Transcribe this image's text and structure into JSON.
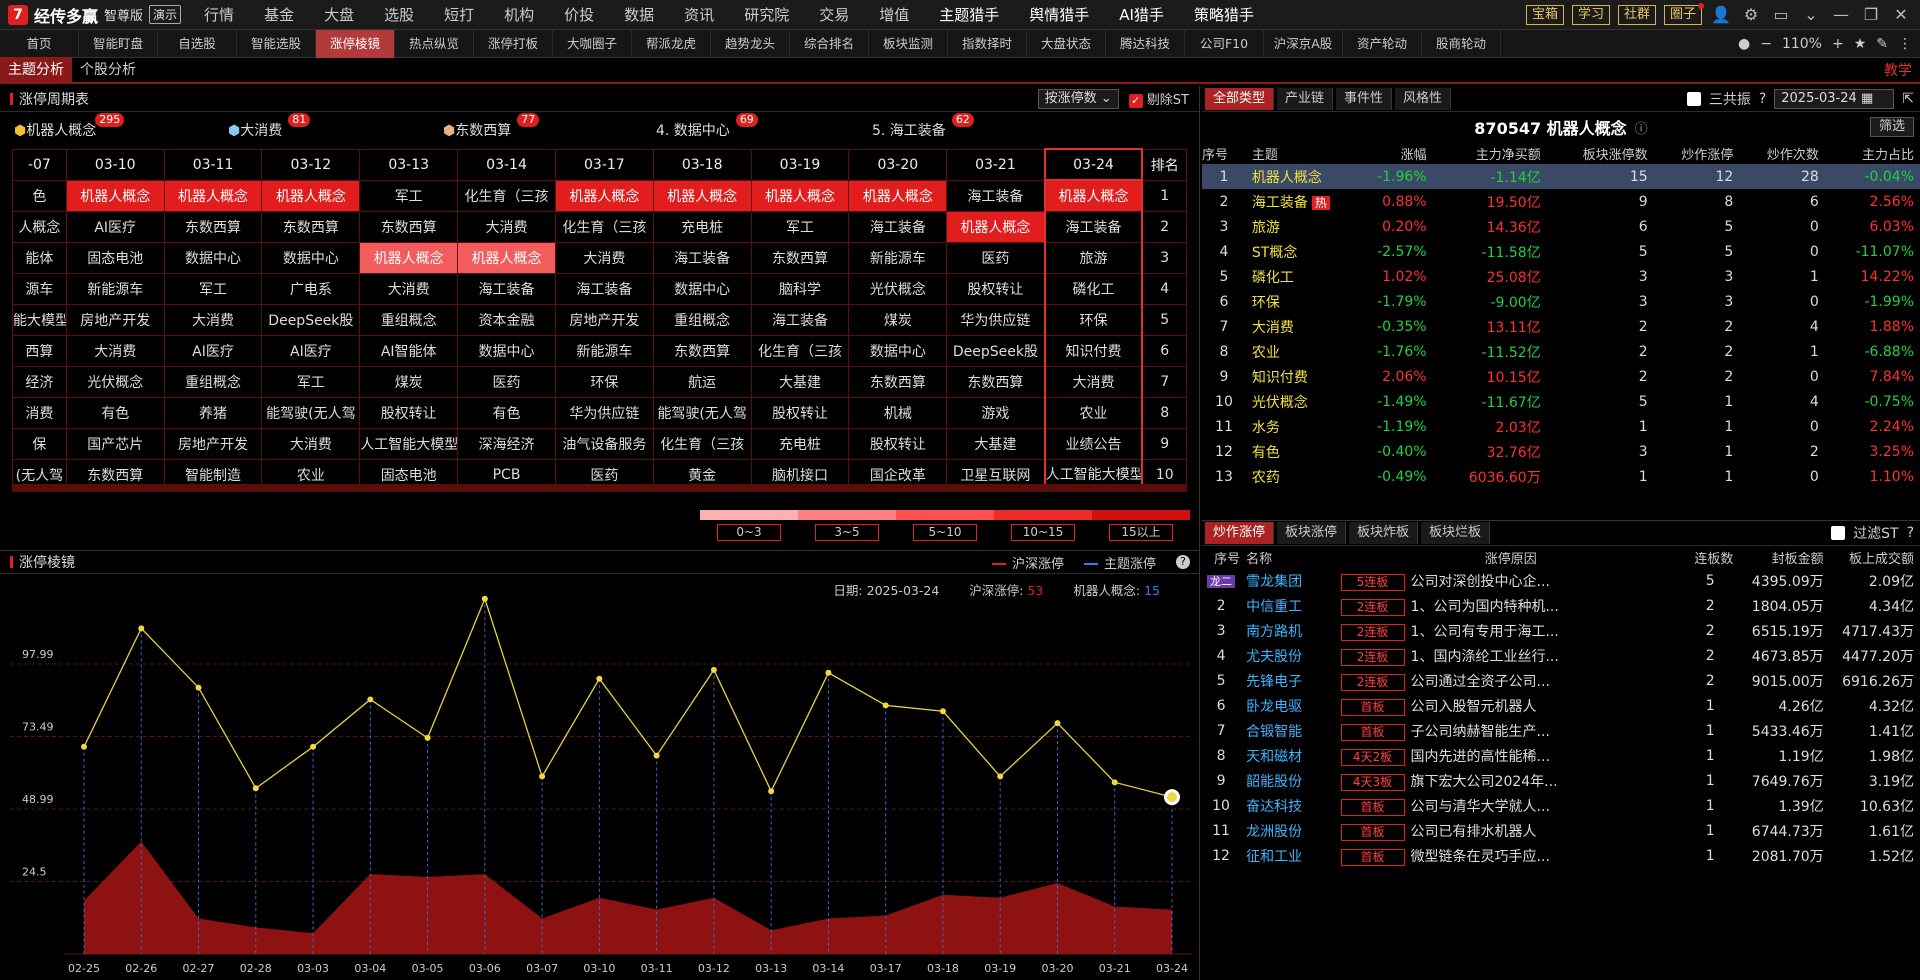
{
  "app": {
    "logo_mark": "7",
    "name": "经传多赢",
    "edition": "智尊版",
    "demo": "演示"
  },
  "top_menu": [
    "行情",
    "基金",
    "大盘",
    "选股",
    "短打",
    "机构",
    "价投",
    "数据",
    "资讯",
    "研究院",
    "交易",
    "增值",
    "主题猎手",
    "舆情猎手",
    "AI猎手",
    "策略猎手"
  ],
  "top_buttons": [
    "宝箱",
    "学习",
    "社群",
    "圈子"
  ],
  "tabs": [
    "首页",
    "智能盯盘",
    "自选股",
    "智能选股",
    "涨停棱镜",
    "热点纵览",
    "涨停打板",
    "大咖圈子",
    "帮派龙虎",
    "趋势龙头",
    "综合排名",
    "板块监测",
    "指数择时",
    "大盘状态",
    "腾达科技",
    "公司F10",
    "沪深京A股",
    "资产轮动",
    "股商轮动"
  ],
  "zoom": "110%",
  "subtabs": [
    "主题分析",
    "个股分析"
  ],
  "teach": "教学",
  "cycle": {
    "title": "涨停周期表",
    "sort": "按涨停数",
    "exclude_st": "剔除ST",
    "themes": [
      {
        "label": "机器人概念",
        "count": "295"
      },
      {
        "label": "大消费",
        "count": "81"
      },
      {
        "label": "东数西算",
        "count": "77"
      },
      {
        "label": "4. 数据中心",
        "count": "69"
      },
      {
        "label": "5. 海工装备",
        "count": "62"
      }
    ],
    "dates": [
      "-07",
      "03-10",
      "03-11",
      "03-12",
      "03-13",
      "03-14",
      "03-17",
      "03-18",
      "03-19",
      "03-20",
      "03-21",
      "03-24"
    ],
    "rank_header": "排名",
    "rows": [
      [
        "色",
        "机器人概念",
        "机器人概念",
        "机器人概念",
        "军工",
        "化生育（三孩",
        "机器人概念",
        "机器人概念",
        "机器人概念",
        "机器人概念",
        "海工装备",
        "机器人概念"
      ],
      [
        "人概念",
        "AI医疗",
        "东数西算",
        "东数西算",
        "东数西算",
        "大消费",
        "化生育（三孩",
        "充电桩",
        "军工",
        "海工装备",
        "机器人概念",
        "海工装备"
      ],
      [
        "能体",
        "固态电池",
        "数据中心",
        "数据中心",
        "机器人概念",
        "机器人概念",
        "大消费",
        "海工装备",
        "东数西算",
        "新能源车",
        "医药",
        "旅游"
      ],
      [
        "源车",
        "新能源车",
        "军工",
        "广电系",
        "大消费",
        "海工装备",
        "海工装备",
        "数据中心",
        "脑科学",
        "光伏概念",
        "股权转让",
        "磷化工"
      ],
      [
        "能大模型",
        "房地产开发",
        "大消费",
        "DeepSeek股",
        "重组概念",
        "资本金融",
        "房地产开发",
        "重组概念",
        "海工装备",
        "煤炭",
        "华为供应链",
        "环保"
      ],
      [
        "西算",
        "大消费",
        "AI医疗",
        "AI医疗",
        "AI智能体",
        "数据中心",
        "新能源车",
        "东数西算",
        "化生育（三孩",
        "数据中心",
        "DeepSeek股",
        "知识付费"
      ],
      [
        "经济",
        "光伏概念",
        "重组概念",
        "军工",
        "煤炭",
        "医药",
        "环保",
        "航运",
        "大基建",
        "东数西算",
        "东数西算",
        "大消费"
      ],
      [
        "消费",
        "有色",
        "养猪",
        "能驾驶(无人驾",
        "股权转让",
        "有色",
        "华为供应链",
        "能驾驶(无人驾",
        "股权转让",
        "机械",
        "游戏",
        "农业"
      ],
      [
        "保",
        "国产芯片",
        "房地产开发",
        "大消费",
        "人工智能大模型",
        "深海经济",
        "油气设备服务",
        "化生育（三孩",
        "充电桩",
        "股权转让",
        "大基建",
        "业绩公告"
      ],
      [
        "(无人驾",
        "东数西算",
        "智能制造",
        "农业",
        "固态电池",
        "PCB",
        "医药",
        "黄金",
        "脑机接口",
        "国企改革",
        "卫星互联网",
        "人工智能大模型"
      ]
    ],
    "legend": [
      "0~3",
      "3~5",
      "5~10",
      "10~15",
      "15以上"
    ]
  },
  "prism": {
    "title": "涨停棱镜",
    "legend_a": "沪深涨停",
    "legend_b": "主题涨停",
    "info_date_label": "日期:",
    "info_date": "2025-03-24",
    "info_a_label": "沪深涨停:",
    "info_a": "53",
    "info_b_label": "机器人概念:",
    "info_b": "15"
  },
  "chart_data": {
    "type": "line",
    "x": [
      "02-25",
      "02-26",
      "02-27",
      "02-28",
      "03-03",
      "03-04",
      "03-05",
      "03-06",
      "03-07",
      "03-10",
      "03-11",
      "03-12",
      "03-13",
      "03-14",
      "03-17",
      "03-18",
      "03-19",
      "03-20",
      "03-21",
      "03-24"
    ],
    "yticks": [
      24.5,
      48.99,
      73.49,
      97.99
    ],
    "ylim": [
      0,
      125
    ],
    "series": [
      {
        "name": "沪深涨停",
        "type": "area",
        "values": [
          18,
          38,
          12,
          9,
          7,
          27,
          26,
          27,
          12,
          19,
          15,
          19,
          8,
          12,
          13,
          20,
          19,
          24,
          16,
          15
        ]
      },
      {
        "name": "主题涨停",
        "type": "line",
        "values": [
          70,
          110,
          90,
          56,
          70,
          86,
          73,
          120,
          60,
          93,
          67,
          96,
          55,
          95,
          84,
          82,
          60,
          78,
          58,
          53
        ]
      }
    ]
  },
  "right": {
    "tabs": [
      "全部类型",
      "产业链",
      "事件性",
      "风格性"
    ],
    "sanzhen": "三共振",
    "date": "2025-03-24",
    "stock_title": "870547 机器人概念",
    "filter": "筛选",
    "headers": [
      "序号",
      "主题",
      "涨幅",
      "主力净买额",
      "板块涨停数",
      "炒作涨停",
      "炒作次数",
      "主力占比"
    ],
    "rows": [
      [
        "1",
        "机器人概念",
        "-1.96%",
        "-1.14亿",
        "15",
        "12",
        "28",
        "-0.04%"
      ],
      [
        "2",
        "海工装备",
        "0.88%",
        "19.50亿",
        "9",
        "8",
        "6",
        "2.56%"
      ],
      [
        "3",
        "旅游",
        "0.20%",
        "14.36亿",
        "6",
        "5",
        "0",
        "6.03%"
      ],
      [
        "4",
        "ST概念",
        "-2.57%",
        "-11.58亿",
        "5",
        "5",
        "0",
        "-11.07%"
      ],
      [
        "5",
        "磷化工",
        "1.02%",
        "25.08亿",
        "3",
        "3",
        "1",
        "14.22%"
      ],
      [
        "6",
        "环保",
        "-1.79%",
        "-9.00亿",
        "3",
        "3",
        "0",
        "-1.99%"
      ],
      [
        "7",
        "大消费",
        "-0.35%",
        "13.11亿",
        "2",
        "2",
        "4",
        "1.88%"
      ],
      [
        "8",
        "农业",
        "-1.76%",
        "-11.52亿",
        "2",
        "2",
        "1",
        "-6.88%"
      ],
      [
        "9",
        "知识付费",
        "2.06%",
        "10.15亿",
        "2",
        "2",
        "0",
        "7.84%"
      ],
      [
        "10",
        "光伏概念",
        "-1.49%",
        "-11.67亿",
        "5",
        "1",
        "4",
        "-0.75%"
      ],
      [
        "11",
        "水务",
        "-1.19%",
        "2.03亿",
        "1",
        "1",
        "0",
        "2.24%"
      ],
      [
        "12",
        "有色",
        "-0.40%",
        "32.76亿",
        "3",
        "1",
        "2",
        "3.25%"
      ],
      [
        "13",
        "农药",
        "-0.49%",
        "6036.60万",
        "1",
        "1",
        "0",
        "1.10%"
      ]
    ],
    "hot_label": "热",
    "tabs2": [
      "炒作涨停",
      "板块涨停",
      "板块炸板",
      "板块烂板"
    ],
    "filter_st": "过滤ST",
    "headers2": [
      "序号",
      "名称",
      "涨停原因",
      "连板数",
      "封板金额",
      "板上成交额"
    ],
    "rows2": [
      [
        "1",
        "雪龙集团",
        "5连板",
        "公司对深创投中心企...",
        "5",
        "4395.09万",
        "2.09亿"
      ],
      [
        "2",
        "中信重工",
        "2连板",
        "1、公司为国内特种机...",
        "2",
        "1804.05万",
        "4.34亿"
      ],
      [
        "3",
        "南方路机",
        "2连板",
        "1、公司有专用于海工...",
        "2",
        "6515.19万",
        "4717.43万"
      ],
      [
        "4",
        "尤夫股份",
        "2连板",
        "1、国内涤纶工业丝行...",
        "2",
        "4673.85万",
        "4477.20万"
      ],
      [
        "5",
        "先锋电子",
        "2连板",
        "公司通过全资子公司...",
        "2",
        "9015.00万",
        "6916.26万"
      ],
      [
        "6",
        "卧龙电驱",
        "首板",
        "公司入股智元机器人",
        "1",
        "4.26亿",
        "4.32亿"
      ],
      [
        "7",
        "合锻智能",
        "首板",
        "子公司纳赫智能生产...",
        "1",
        "5433.46万",
        "1.41亿"
      ],
      [
        "8",
        "天和磁材",
        "4天2板",
        "国内先进的高性能稀...",
        "1",
        "1.19亿",
        "1.98亿"
      ],
      [
        "9",
        "韶能股份",
        "4天3板",
        "旗下宏大公司2024年...",
        "1",
        "7649.76万",
        "3.19亿"
      ],
      [
        "10",
        "奋达科技",
        "首板",
        "公司与清华大学就人...",
        "1",
        "1.39亿",
        "10.63亿"
      ],
      [
        "11",
        "龙洲股份",
        "首板",
        "公司已有排水机器人",
        "1",
        "6744.73万",
        "1.61亿"
      ],
      [
        "12",
        "征和工业",
        "首板",
        "微型链条在灵巧手应...",
        "1",
        "2081.70万",
        "1.52亿"
      ]
    ],
    "dragon": "龙二"
  }
}
